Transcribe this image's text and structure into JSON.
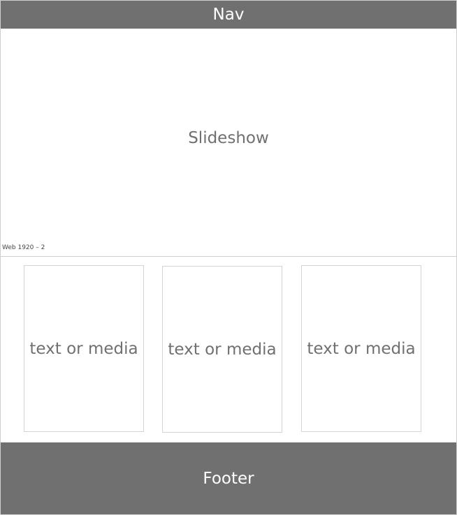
{
  "nav": {
    "label": "Nav"
  },
  "slideshow": {
    "label": "Slideshow"
  },
  "artboard": {
    "name": "Web 1920 – 2"
  },
  "cards": [
    {
      "label": "text or media"
    },
    {
      "label": "text or media"
    },
    {
      "label": "text or media"
    }
  ],
  "footer": {
    "label": "Footer"
  },
  "colors": {
    "bar": "#707070",
    "placeholder_text": "#707070",
    "border": "#cfcfcf",
    "background": "#ffffff"
  }
}
